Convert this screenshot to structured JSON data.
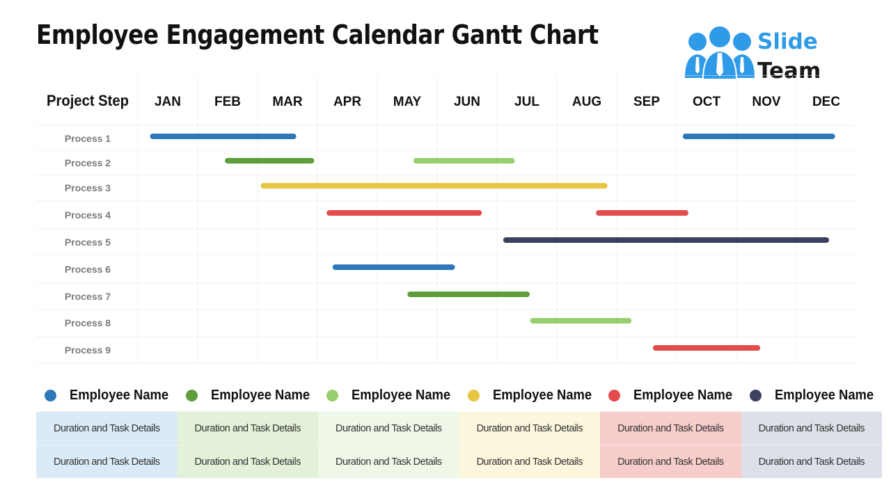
{
  "title": "Employee Engagement Calendar Gantt Chart",
  "logo": {
    "line1": "Slide",
    "line2": "Team",
    "icon": "team-people-icon",
    "color": "#2f9be8"
  },
  "chart_data": {
    "type": "gantt",
    "title": "Employee Engagement Calendar Gantt Chart",
    "row_header": "Project Step",
    "months": [
      "JAN",
      "FEB",
      "MAR",
      "APR",
      "MAY",
      "JUN",
      "JUL",
      "AUG",
      "SEP",
      "OCT",
      "NOV",
      "DEC"
    ],
    "x_range_months": [
      0,
      12
    ],
    "grid": true,
    "colors": {
      "blue": "#2e78b8",
      "darkgreen": "#5f9e3a",
      "lightgreen": "#96cf6e",
      "yellow": "#e6c541",
      "red": "#e44b4b",
      "navy": "#3d4160"
    },
    "rows": [
      {
        "label": "Process 1",
        "bars": [
          {
            "start": 0.25,
            "end": 2.6,
            "color": "blue"
          },
          {
            "start": 9.15,
            "end": 11.6,
            "color": "blue"
          }
        ]
      },
      {
        "label": "Process 2",
        "bars": [
          {
            "start": 1.5,
            "end": 2.9,
            "color": "darkgreen"
          },
          {
            "start": 4.65,
            "end": 6.25,
            "color": "lightgreen"
          }
        ]
      },
      {
        "label": "Process 3",
        "bars": [
          {
            "start": 2.1,
            "end": 7.8,
            "color": "yellow"
          }
        ]
      },
      {
        "label": "Process 4",
        "bars": [
          {
            "start": 3.2,
            "end": 5.7,
            "color": "red"
          },
          {
            "start": 7.7,
            "end": 9.15,
            "color": "red"
          }
        ]
      },
      {
        "label": "Process 5",
        "bars": [
          {
            "start": 6.15,
            "end": 11.5,
            "color": "navy"
          }
        ]
      },
      {
        "label": "Process 6",
        "bars": [
          {
            "start": 3.3,
            "end": 5.25,
            "color": "blue"
          }
        ]
      },
      {
        "label": "Process 7",
        "bars": [
          {
            "start": 4.55,
            "end": 6.5,
            "color": "darkgreen"
          }
        ]
      },
      {
        "label": "Process 8",
        "bars": [
          {
            "start": 6.6,
            "end": 8.2,
            "color": "lightgreen"
          }
        ]
      },
      {
        "label": "Process 9",
        "bars": [
          {
            "start": 8.65,
            "end": 10.35,
            "color": "red"
          }
        ]
      }
    ],
    "legend": [
      {
        "name": "Employee Name",
        "color": "blue",
        "bg": "#daeaf6",
        "details": [
          "Duration and Task Details",
          "Duration and Task Details"
        ]
      },
      {
        "name": "Employee Name",
        "color": "darkgreen",
        "bg": "#e3f1d8",
        "details": [
          "Duration and Task Details",
          "Duration and Task Details"
        ]
      },
      {
        "name": "Employee Name",
        "color": "lightgreen",
        "bg": "#eef7e8",
        "details": [
          "Duration and Task Details",
          "Duration and Task Details"
        ]
      },
      {
        "name": "Employee Name",
        "color": "yellow",
        "bg": "#fbf6dc",
        "details": [
          "Duration and Task Details",
          "Duration and Task Details"
        ]
      },
      {
        "name": "Employee Name",
        "color": "red",
        "bg": "#f7cdcb",
        "details": [
          "Duration and Task Details",
          "Duration and Task Details"
        ]
      },
      {
        "name": "Employee Name",
        "color": "navy",
        "bg": "#dde0e8",
        "details": [
          "Duration and Task Details",
          "Duration and Task Details"
        ]
      }
    ]
  }
}
